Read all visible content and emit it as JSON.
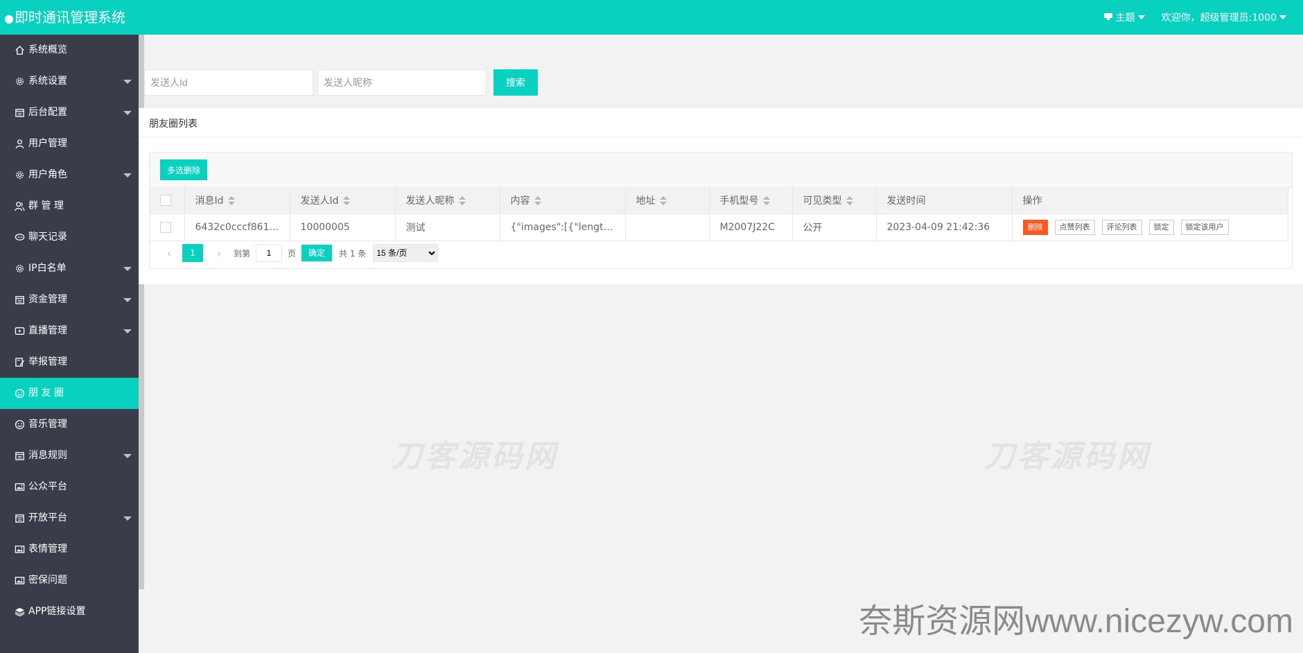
{
  "header": {
    "title": "即时通讯管理系统",
    "theme_label": "主题",
    "welcome": "欢迎你，超级管理员:1000"
  },
  "sidebar": {
    "items": [
      {
        "label": "系统概览",
        "icon": "home-icon",
        "has_sub": false,
        "active": false
      },
      {
        "label": "系统设置",
        "icon": "gear-icon",
        "has_sub": true,
        "active": false
      },
      {
        "label": "后台配置",
        "icon": "calendar-icon",
        "has_sub": true,
        "active": false
      },
      {
        "label": "用户管理",
        "icon": "user-icon",
        "has_sub": false,
        "active": false
      },
      {
        "label": "用户角色",
        "icon": "gear-icon",
        "has_sub": true,
        "active": false
      },
      {
        "label": "群 管 理",
        "icon": "group-icon",
        "has_sub": false,
        "active": false
      },
      {
        "label": "聊天记录",
        "icon": "chat-icon",
        "has_sub": false,
        "active": false
      },
      {
        "label": "IP白名单",
        "icon": "gear-icon",
        "has_sub": true,
        "active": false
      },
      {
        "label": "资金管理",
        "icon": "calendar-icon",
        "has_sub": true,
        "active": false
      },
      {
        "label": "直播管理",
        "icon": "video-icon",
        "has_sub": true,
        "active": false
      },
      {
        "label": "举报管理",
        "icon": "report-icon",
        "has_sub": false,
        "active": false
      },
      {
        "label": "朋 友 圈",
        "icon": "smile-icon",
        "has_sub": false,
        "active": true
      },
      {
        "label": "音乐管理",
        "icon": "smile-icon",
        "has_sub": false,
        "active": false
      },
      {
        "label": "消息规则",
        "icon": "calendar-icon",
        "has_sub": true,
        "active": false
      },
      {
        "label": "公众平台",
        "icon": "image-icon",
        "has_sub": false,
        "active": false
      },
      {
        "label": "开放平台",
        "icon": "calendar-icon",
        "has_sub": true,
        "active": false
      },
      {
        "label": "表情管理",
        "icon": "image-icon",
        "has_sub": false,
        "active": false
      },
      {
        "label": "密保问题",
        "icon": "image-icon",
        "has_sub": false,
        "active": false
      },
      {
        "label": "APP链接设置",
        "icon": "layers-icon",
        "has_sub": false,
        "active": false
      }
    ]
  },
  "search": {
    "sender_id_placeholder": "发送人Id",
    "sender_nick_placeholder": "发送人昵称",
    "button": "搜索"
  },
  "panel": {
    "title": "朋友圈列表"
  },
  "toolbar": {
    "multi_delete": "多选删除"
  },
  "table": {
    "columns": [
      "消息Id",
      "发送人Id",
      "发送人昵称",
      "内容",
      "地址",
      "手机型号",
      "可见类型",
      "发送时间",
      "操作"
    ],
    "rows": [
      {
        "msg_id": "6432c0cccf861d…",
        "sender_id": "10000005",
        "sender_nick": "测试",
        "content": "{\"images\":[{\"length\":0,…",
        "address": "",
        "phone_model": "M2007J22C",
        "visible": "公开",
        "time": "2023-04-09 21:42:36"
      }
    ],
    "actions": [
      "删除",
      "点赞列表",
      "评论列表",
      "锁定",
      "锁定该用户"
    ]
  },
  "pager": {
    "current": "1",
    "goto_label": "到第",
    "goto_value": "1",
    "page_label": "页",
    "ok": "确定",
    "total": "共 1 条",
    "page_size": "15 条/页"
  },
  "watermarks": {
    "center": "刀客源码网",
    "bottom": "奈斯资源网www.nicezyw.com"
  },
  "colors": {
    "accent": "#08d1bf",
    "sidebar": "#393d49",
    "danger": "#ff5722"
  }
}
